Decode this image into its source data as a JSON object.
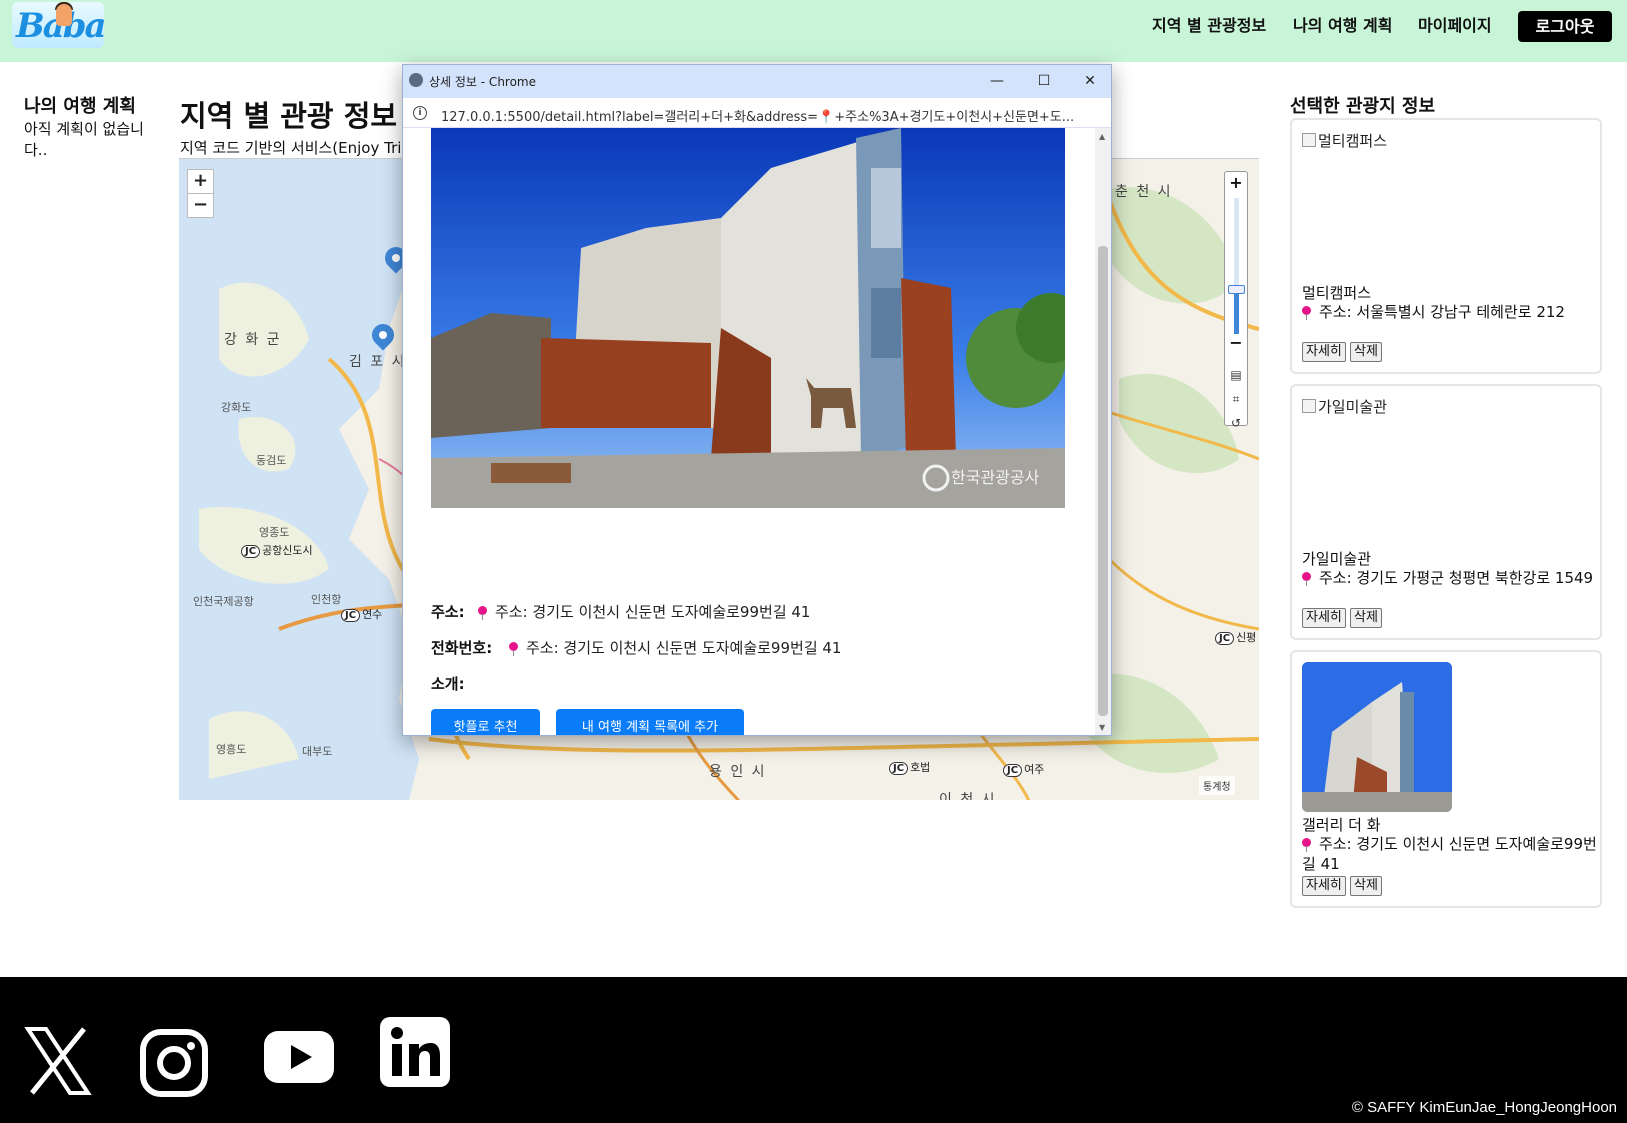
{
  "header": {
    "logo_text": "Baba",
    "nav": [
      "지역 별 관광정보",
      "나의 여행 계획",
      "마이페이지"
    ],
    "logout": "로그아웃"
  },
  "left": {
    "title": "나의 여행 계획",
    "empty": "아직 계획이 없습니다.."
  },
  "center": {
    "title": "지역 별 관광 정보",
    "subtitle": "지역 코드 기반의 서비스(Enjoy Trip)"
  },
  "map": {
    "zoom_in": "+",
    "zoom_out": "−",
    "labels": [
      "강 화 군",
      "김 포 시",
      "춘 천 시",
      "용 인 시",
      "이 천 시"
    ],
    "small_labels": [
      "강화도",
      "동검도",
      "영종도",
      "영흥도",
      "대부도",
      "인천국제공항",
      "인천항"
    ],
    "jc_labels": [
      "공항신도시",
      "연수",
      "호법",
      "여주",
      "신평"
    ],
    "attribution": "통계청"
  },
  "popup": {
    "window_title": "상세 정보 - Chrome",
    "url": "127.0.0.1:5500/detail.html?label=갤러리+더+화&address=📍+주소%3A+경기도+이천시+신둔면+도...",
    "image_watermark": "한국관광공사",
    "address_label": "주소:",
    "address_value": "주소: 경기도 이천시 신둔면 도자예술로99번길 41",
    "phone_label": "전화번호:",
    "phone_value": "주소: 경기도 이천시 신둔면 도자예술로99번길 41",
    "intro_label": "소개:",
    "btn_recommend": "핫플로 추천",
    "btn_add": "내 여행 계획 목록에 추가"
  },
  "right": {
    "title": "선택한 관광지 정보",
    "cards": [
      {
        "alt": "멀티캠퍼스",
        "name": "멀티캠퍼스",
        "address": "주소: 서울특별시 강남구 테헤란로 212",
        "detail": "자세히",
        "delete": "삭제"
      },
      {
        "alt": "가일미술관",
        "name": "가일미술관",
        "address": "주소: 경기도 가평군 청평면 북한강로 1549",
        "detail": "자세히",
        "delete": "삭제"
      },
      {
        "alt": "",
        "name": "갤러리 더 화",
        "address": "주소: 경기도 이천시 신둔면 도자예술로99번길 41",
        "detail": "자세히",
        "delete": "삭제"
      }
    ]
  },
  "footer": {
    "social": [
      "x-icon",
      "instagram-icon",
      "youtube-icon",
      "linkedin-icon"
    ],
    "copyright": "© SAFFY KimEunJae_HongJeongHoon"
  }
}
